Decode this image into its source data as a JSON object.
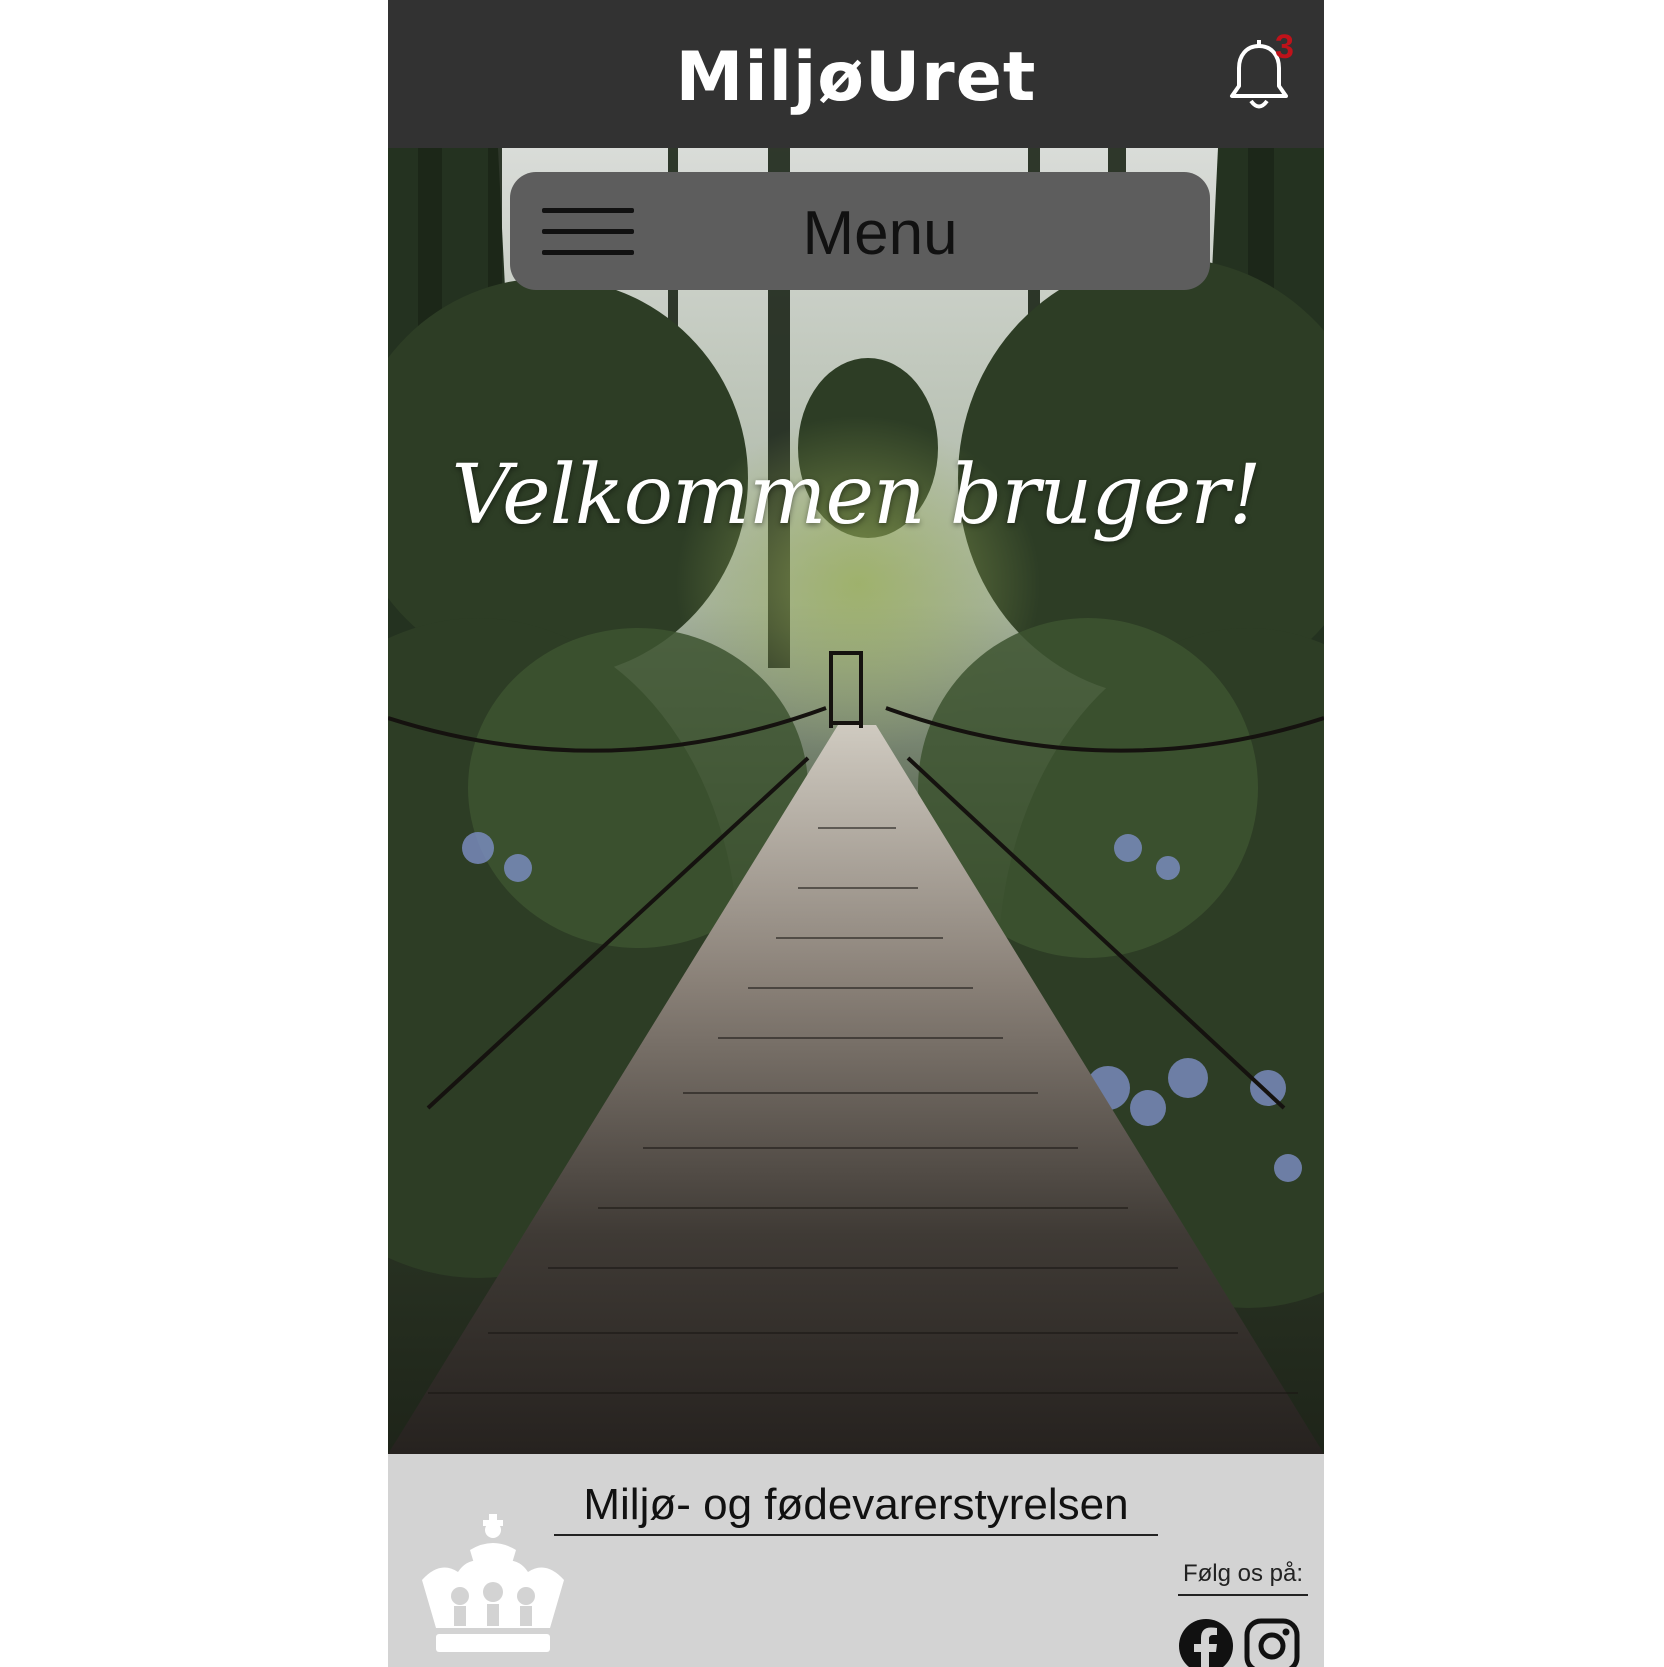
{
  "header": {
    "title": "MiljøUret",
    "notification_count": "3"
  },
  "menu": {
    "label": "Menu"
  },
  "hero": {
    "welcome_text": "Velkommen bruger!"
  },
  "footer": {
    "agency_name": "Miljø- og fødevarerstyrelsen",
    "follow_label": "Følg os på:",
    "social": [
      "facebook-icon",
      "instagram-icon"
    ]
  },
  "colors": {
    "header_bg": "#323232",
    "menu_bg": "#5d5d5d",
    "footer_bg": "#d3d3d3",
    "badge": "#c0121a"
  }
}
